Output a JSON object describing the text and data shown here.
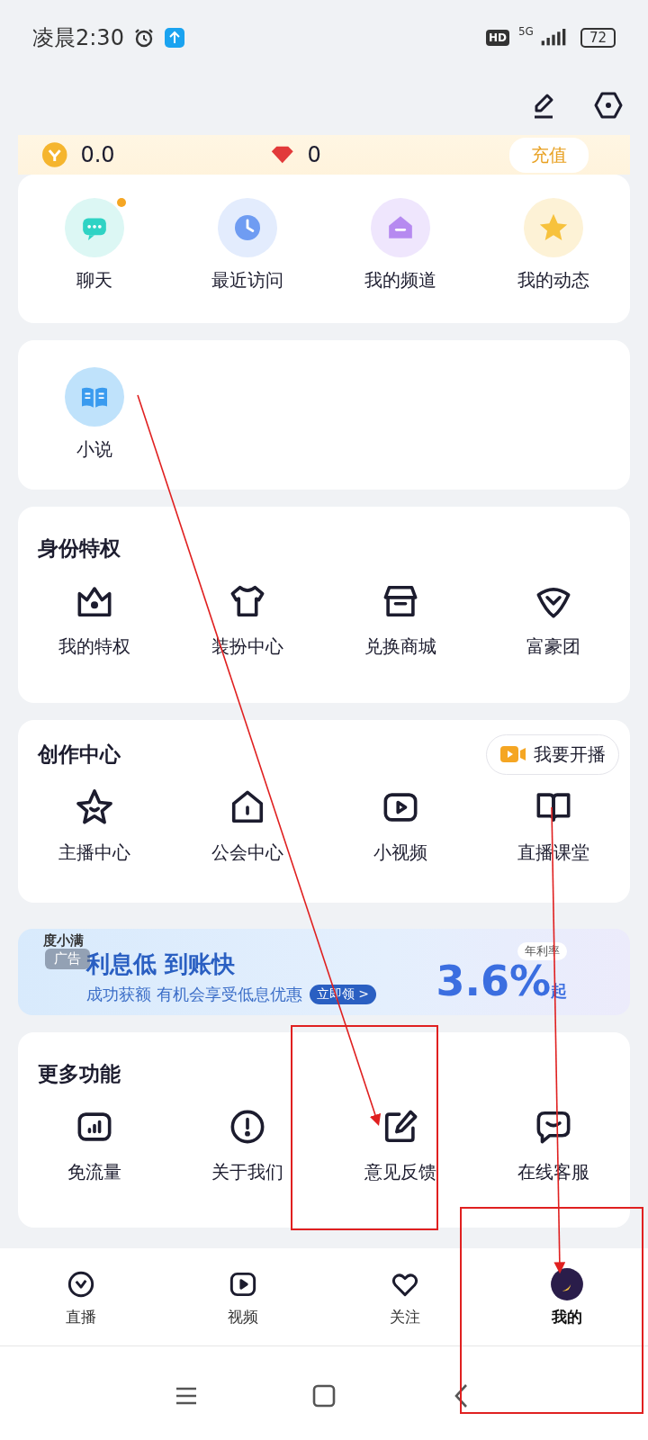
{
  "status_bar": {
    "time": "凌晨2:30",
    "hd": "HD",
    "network": "5G",
    "battery": "72"
  },
  "wallet": {
    "coins": "0.0",
    "gems": "0",
    "recharge": "充值"
  },
  "quick_actions": [
    {
      "label": "聊天",
      "badge": true
    },
    {
      "label": "最近访问",
      "badge": false
    },
    {
      "label": "我的频道",
      "badge": false
    },
    {
      "label": "我的动态",
      "badge": false
    }
  ],
  "apps": [
    {
      "label": "小说"
    }
  ],
  "sections": [
    {
      "title": "身份特权",
      "items": [
        {
          "label": "我的特权"
        },
        {
          "label": "装扮中心"
        },
        {
          "label": "兑换商城"
        },
        {
          "label": "富豪团"
        }
      ]
    },
    {
      "title": "创作中心",
      "action": "我要开播",
      "items": [
        {
          "label": "主播中心"
        },
        {
          "label": "公会中心"
        },
        {
          "label": "小视频"
        },
        {
          "label": "直播课堂"
        }
      ]
    }
  ],
  "ad": {
    "brand": "度小满",
    "tag": "广告",
    "headline": "利息低 到账快",
    "subline": "成功获额 有机会享受低息优惠",
    "cta": "立即领 >",
    "rate_label": "年利率",
    "rate": "3.6%",
    "rate_suffix": "起"
  },
  "more": {
    "title": "更多功能",
    "items": [
      {
        "label": "免流量"
      },
      {
        "label": "关于我们"
      },
      {
        "label": "意见反馈"
      },
      {
        "label": "在线客服"
      }
    ]
  },
  "tabs": [
    {
      "label": "直播",
      "selected": false
    },
    {
      "label": "视频",
      "selected": false
    },
    {
      "label": "关注",
      "selected": false
    },
    {
      "label": "我的",
      "selected": true
    }
  ]
}
